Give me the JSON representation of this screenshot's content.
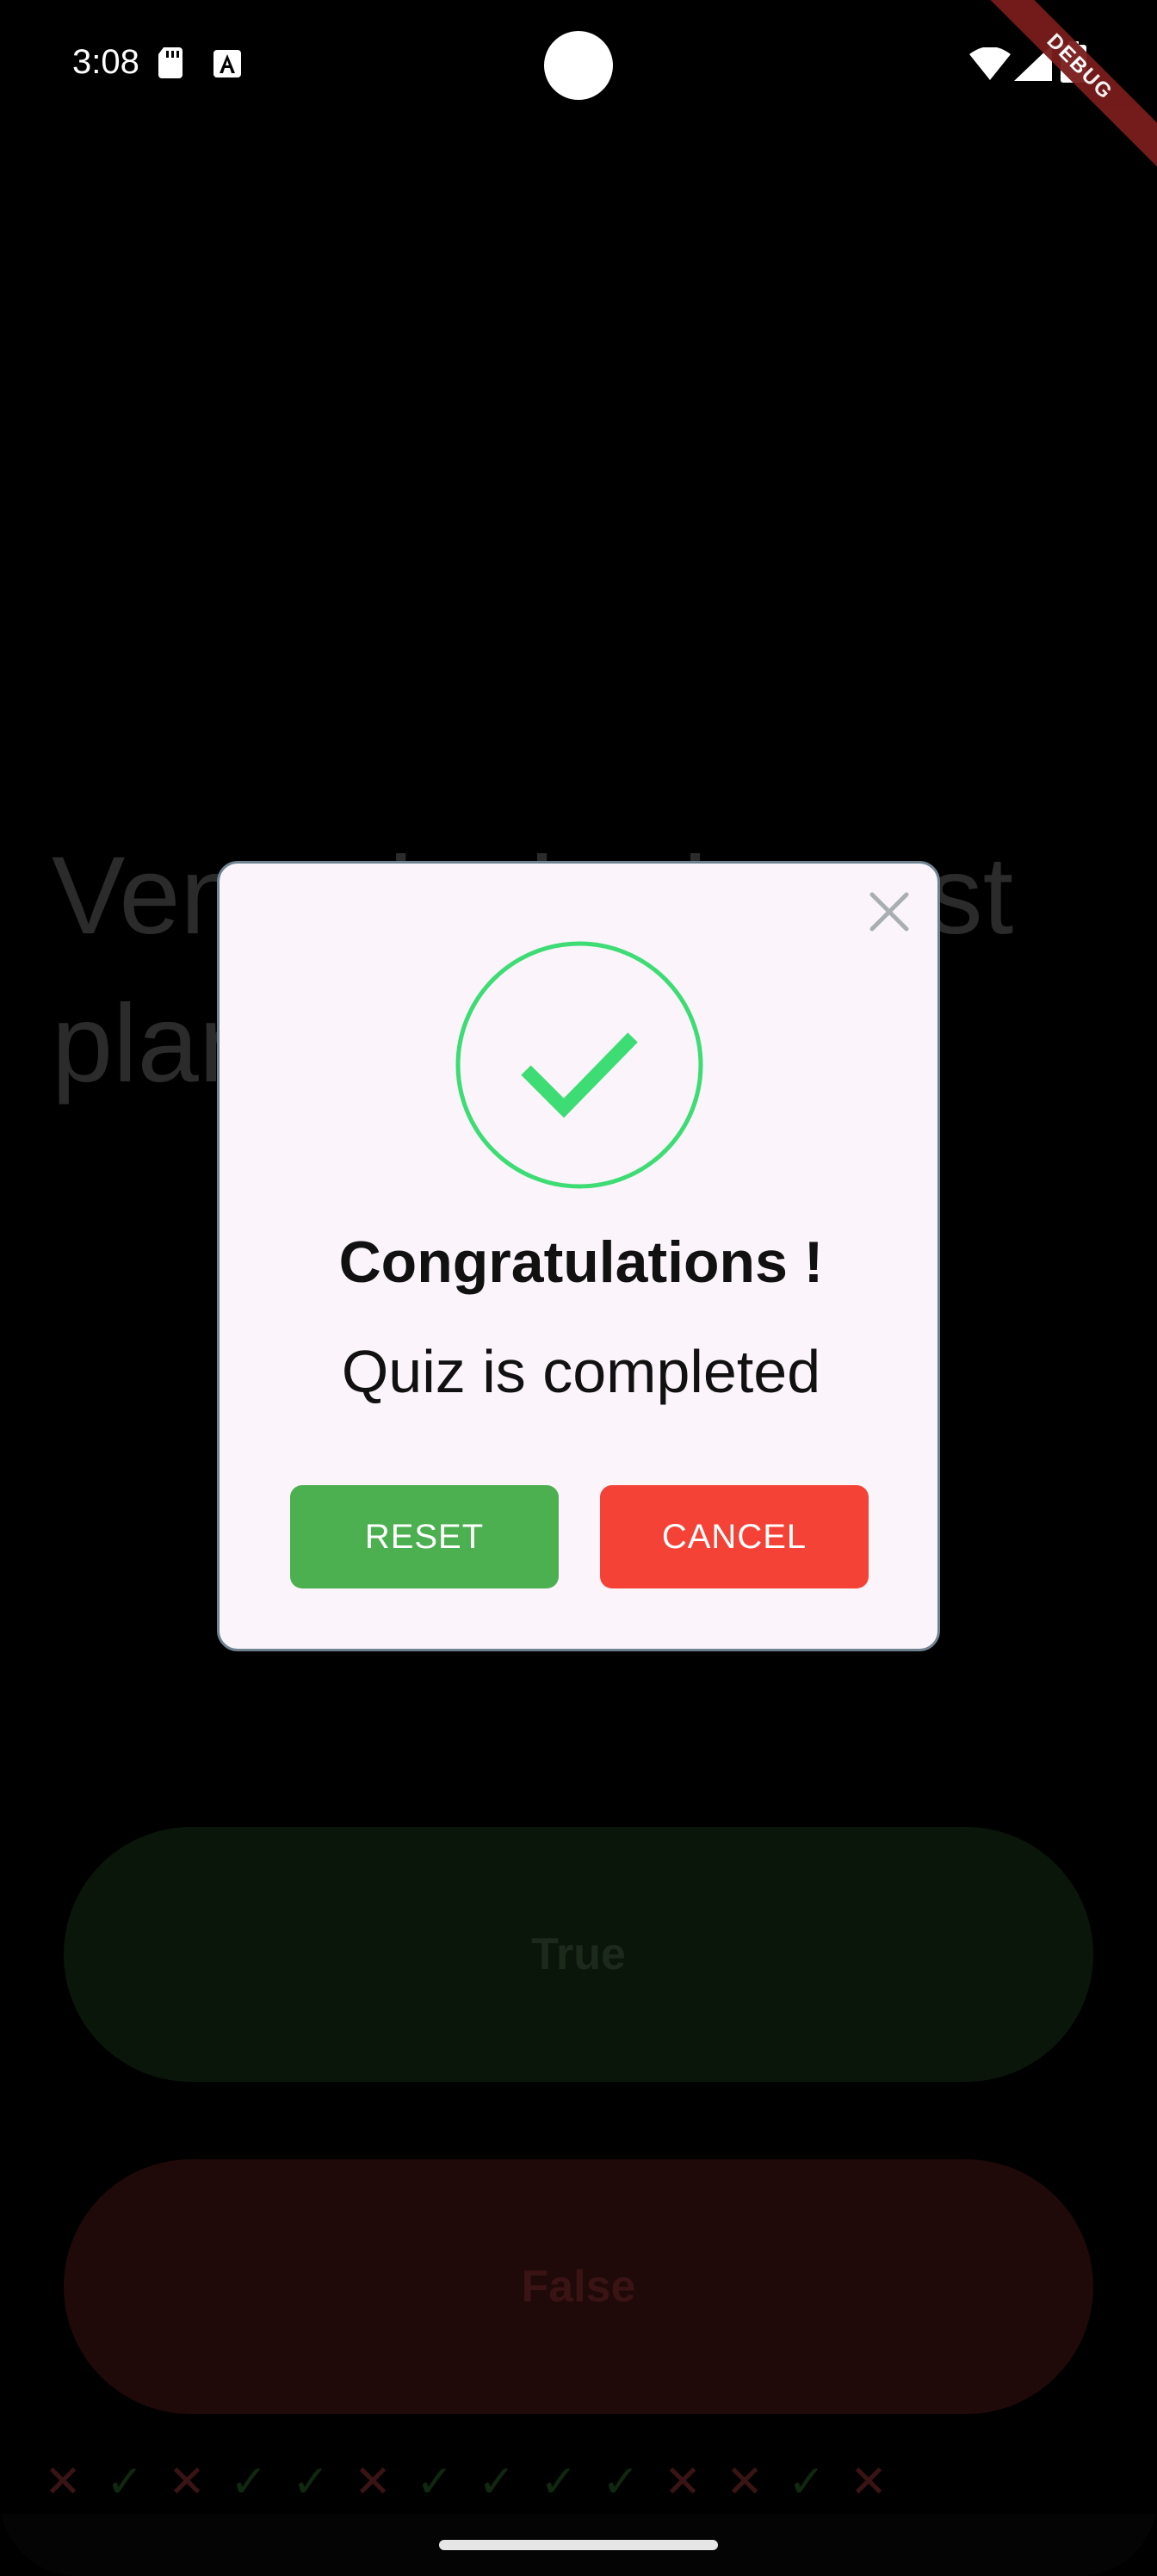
{
  "status_bar": {
    "time": "3:08",
    "icons": [
      "sd-card-icon",
      "a-text-icon",
      "wifi-icon",
      "signal-icon",
      "battery-icon"
    ]
  },
  "debug_banner": "DEBUG",
  "question": {
    "text": "Venus is the hottest planet"
  },
  "answers": {
    "true_label": "True",
    "false_label": "False",
    "true_color": "#0b160b",
    "false_color": "#200909"
  },
  "score_marks": [
    "x",
    "check",
    "x",
    "check",
    "check",
    "x",
    "check",
    "check",
    "check",
    "check",
    "x",
    "x",
    "check",
    "x"
  ],
  "dialog": {
    "title": "Congratulations !",
    "message": "Quiz is completed",
    "reset_label": "RESET",
    "cancel_label": "CANCEL",
    "reset_color": "#4caf50",
    "cancel_color": "#f44336",
    "success_color": "#3ddc74",
    "icon": "check-circle-icon"
  }
}
